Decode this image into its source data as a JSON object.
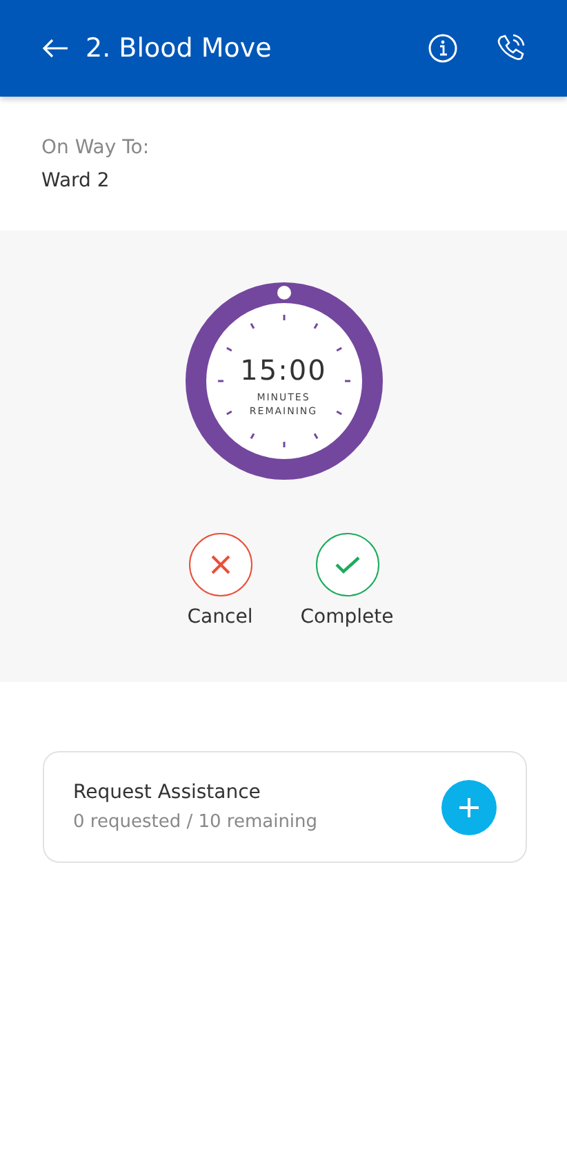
{
  "header": {
    "title": "2. Blood Move"
  },
  "destination": {
    "label": "On Way To:",
    "value": "Ward 2"
  },
  "timer": {
    "time": "15:00",
    "caption_1": "MINUTES",
    "caption_2": "REMAINING"
  },
  "actions": [
    {
      "kind": "cancel",
      "label": "Cancel"
    },
    {
      "kind": "complete",
      "label": "Complete"
    }
  ],
  "assistance": {
    "title": "Request Assistance",
    "status": "0 requested / 10 remaining"
  }
}
